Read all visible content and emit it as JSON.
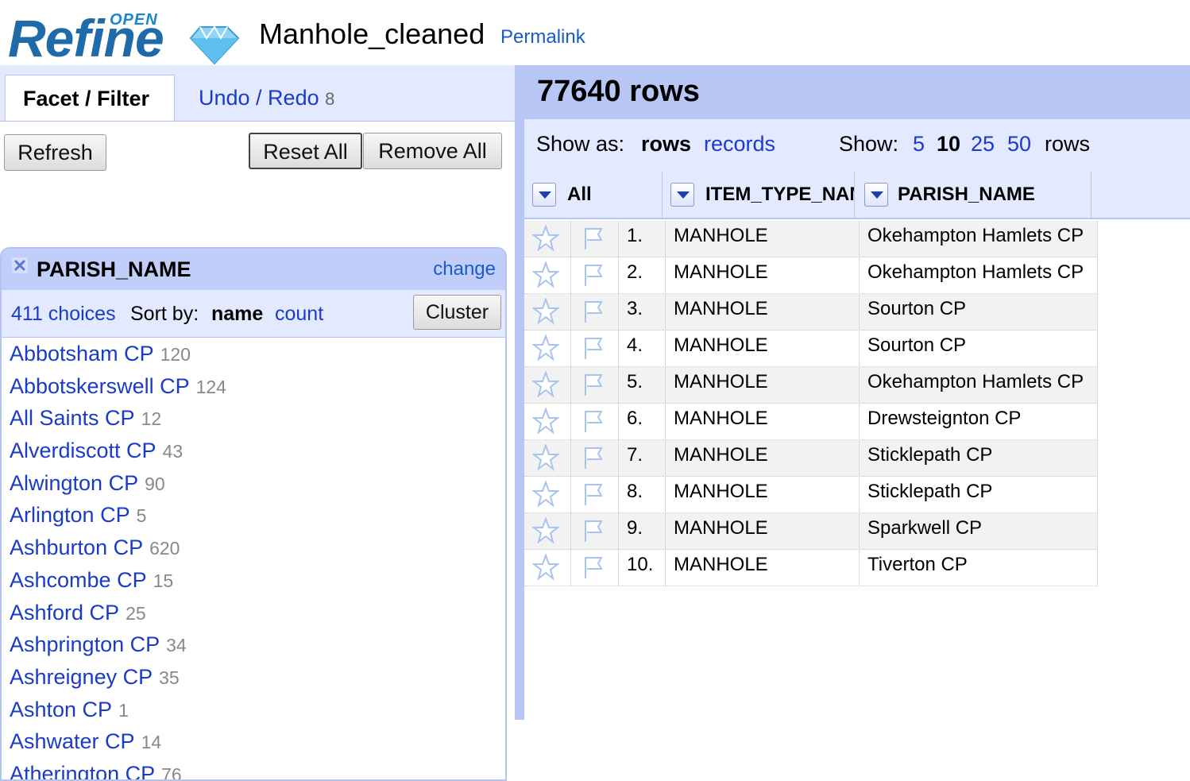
{
  "app": {
    "logo_small": "OPEN",
    "logo_main": "Refine",
    "project_title": "Manhole_cleaned",
    "permalink_label": "Permalink"
  },
  "left_panel": {
    "tabs": [
      {
        "label": "Facet / Filter",
        "active": true
      },
      {
        "label": "Undo / Redo",
        "count": "8",
        "active": false
      }
    ],
    "refresh_label": "Refresh",
    "reset_all_label": "Reset All",
    "remove_all_label": "Remove All",
    "facet": {
      "name": "PARISH_NAME",
      "change_label": "change",
      "choice_count": "411 choices",
      "sort_by_label": "Sort by:",
      "sort_name": "name",
      "sort_count": "count",
      "cluster_label": "Cluster",
      "choices": [
        {
          "name": "Abbotsham CP",
          "count": "120"
        },
        {
          "name": "Abbotskerswell CP",
          "count": "124"
        },
        {
          "name": "All Saints CP",
          "count": "12"
        },
        {
          "name": "Alverdiscott CP",
          "count": "43"
        },
        {
          "name": "Alwington CP",
          "count": "90"
        },
        {
          "name": "Arlington CP",
          "count": "5"
        },
        {
          "name": "Ashburton CP",
          "count": "620"
        },
        {
          "name": "Ashcombe CP",
          "count": "15"
        },
        {
          "name": "Ashford CP",
          "count": "25"
        },
        {
          "name": "Ashprington CP",
          "count": "34"
        },
        {
          "name": "Ashreigney CP",
          "count": "35"
        },
        {
          "name": "Ashton CP",
          "count": "1"
        },
        {
          "name": "Ashwater CP",
          "count": "14"
        },
        {
          "name": "Atherington CP",
          "count": "76"
        }
      ]
    }
  },
  "right_panel": {
    "row_count": "77640 rows",
    "show_as_label": "Show as:",
    "show_as_rows": "rows",
    "show_as_records": "records",
    "show_label": "Show:",
    "page_sizes": [
      "5",
      "10",
      "25",
      "50"
    ],
    "page_size_selected": "10",
    "show_rows_suffix": "rows",
    "columns": [
      "All",
      "ITEM_TYPE_NAME",
      "PARISH_NAME"
    ],
    "rows": [
      {
        "index": "1.",
        "item_type": "MANHOLE",
        "parish": "Okehampton Hamlets CP"
      },
      {
        "index": "2.",
        "item_type": "MANHOLE",
        "parish": "Okehampton Hamlets CP"
      },
      {
        "index": "3.",
        "item_type": "MANHOLE",
        "parish": "Sourton CP"
      },
      {
        "index": "4.",
        "item_type": "MANHOLE",
        "parish": "Sourton CP"
      },
      {
        "index": "5.",
        "item_type": "MANHOLE",
        "parish": "Okehampton Hamlets CP"
      },
      {
        "index": "6.",
        "item_type": "MANHOLE",
        "parish": "Drewsteignton CP"
      },
      {
        "index": "7.",
        "item_type": "MANHOLE",
        "parish": "Sticklepath CP"
      },
      {
        "index": "8.",
        "item_type": "MANHOLE",
        "parish": "Sticklepath CP"
      },
      {
        "index": "9.",
        "item_type": "MANHOLE",
        "parish": "Sparkwell CP"
      },
      {
        "index": "10.",
        "item_type": "MANHOLE",
        "parish": "Tiverton CP"
      }
    ]
  },
  "colors": {
    "link": "#1a3bc8",
    "panel_bg": "#e3e9ff",
    "header_band": "#b8c6f5",
    "logo_blue": "#1f6aa8"
  }
}
